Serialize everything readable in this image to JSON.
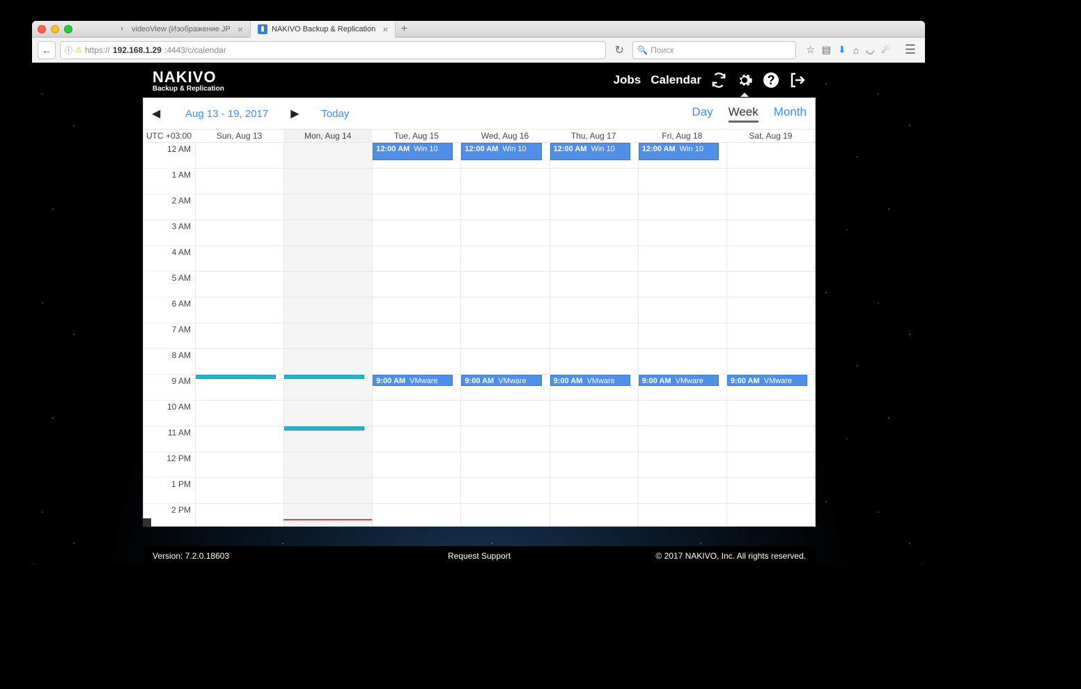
{
  "browser": {
    "tabs": [
      {
        "label": "videoView (Изображение JP",
        "active": false
      },
      {
        "label": "NAKIVO Backup & Replication",
        "active": true
      }
    ],
    "url_parts": {
      "scheme": "https://",
      "host": "192.168.1.29",
      "rest": ":4443/c/calendar"
    },
    "search_placeholder": "Поиск"
  },
  "header": {
    "brand": "NAKIVO",
    "subtitle": "Backup & Replication",
    "links": {
      "jobs": "Jobs",
      "calendar": "Calendar"
    }
  },
  "toolbar": {
    "range": "Aug 13 - 19, 2017",
    "today_label": "Today",
    "views": {
      "day": "Day",
      "week": "Week",
      "month": "Month",
      "active": "week"
    }
  },
  "calendar": {
    "tz": "UTC +03:00",
    "days": [
      "Sun, Aug 13",
      "Mon, Aug 14",
      "Tue, Aug 15",
      "Wed, Aug 16",
      "Thu, Aug 17",
      "Fri, Aug 18",
      "Sat, Aug 19"
    ],
    "today_index": 1,
    "hours": [
      "12 AM",
      "1 AM",
      "2 AM",
      "3 AM",
      "4 AM",
      "5 AM",
      "6 AM",
      "7 AM",
      "8 AM",
      "9 AM",
      "10 AM",
      "11 AM",
      "12 PM",
      "1 PM",
      "2 PM"
    ],
    "events": [
      {
        "day": 2,
        "hour": 0,
        "time": "12:00 AM",
        "name": "Win 10",
        "rows": 1
      },
      {
        "day": 3,
        "hour": 0,
        "time": "12:00 AM",
        "name": "Win 10",
        "rows": 1
      },
      {
        "day": 4,
        "hour": 0,
        "time": "12:00 AM",
        "name": "Win 10",
        "rows": 1
      },
      {
        "day": 5,
        "hour": 0,
        "time": "12:00 AM",
        "name": "Win 10",
        "rows": 1
      },
      {
        "day": 2,
        "hour": 9,
        "time": "9:00 AM",
        "name": "VMware"
      },
      {
        "day": 3,
        "hour": 9,
        "time": "9:00 AM",
        "name": "VMware"
      },
      {
        "day": 4,
        "hour": 9,
        "time": "9:00 AM",
        "name": "VMware"
      },
      {
        "day": 5,
        "hour": 9,
        "time": "9:00 AM",
        "name": "VMware"
      },
      {
        "day": 6,
        "hour": 9,
        "time": "9:00 AM",
        "name": "VMware"
      }
    ],
    "past_bars": [
      {
        "day": 0,
        "hour": 9
      },
      {
        "day": 1,
        "hour": 9
      },
      {
        "day": 1,
        "hour": 11
      }
    ],
    "now_marker": {
      "day": 1,
      "hour_fraction": 14.6
    }
  },
  "footer": {
    "version": "Version: 7.2.0.18603",
    "support": "Request Support",
    "copyright": "© 2017 NAKIVO, Inc. All rights reserved."
  }
}
